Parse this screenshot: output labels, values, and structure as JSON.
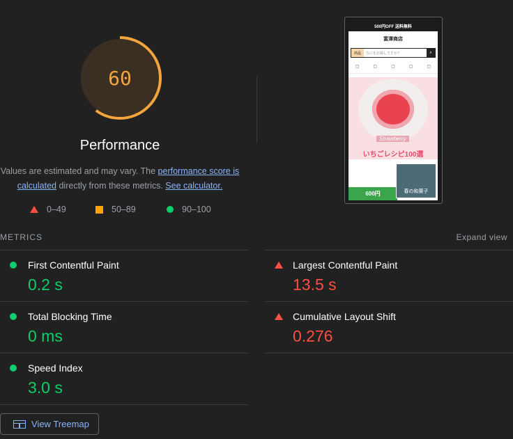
{
  "performance": {
    "score": "60",
    "score_value": 0.6,
    "title": "Performance",
    "gauge_color": "#f4a53c",
    "description_pre": "Values are estimated and may vary. The ",
    "description_link1": "performance score is calculated",
    "description_mid": " directly from these metrics. ",
    "description_link2": "See calculator."
  },
  "legend": [
    {
      "label": "0–49",
      "shape": "triangle",
      "color": "#ff4e42"
    },
    {
      "label": "50–89",
      "shape": "square",
      "color": "#ffa400"
    },
    {
      "label": "90–100",
      "shape": "circle",
      "color": "#0cce6b"
    }
  ],
  "screenshot": {
    "banner": "500円OFF 送料無料",
    "site_name": "富澤商店",
    "search_category": "商品",
    "search_placeholder": "なにをお探しですか?",
    "hero_label": "Strawberry",
    "hero_text": "いちごレシピ100選",
    "popup_text": "春の和菓子",
    "bottom_text": "600円"
  },
  "metrics": {
    "header": "METRICS",
    "expand_label": "Expand view",
    "left": [
      {
        "name": "First Contentful Paint",
        "value": "0.2 s",
        "status": "pass"
      },
      {
        "name": "Total Blocking Time",
        "value": "0 ms",
        "status": "pass"
      },
      {
        "name": "Speed Index",
        "value": "3.0 s",
        "status": "pass"
      }
    ],
    "right": [
      {
        "name": "Largest Contentful Paint",
        "value": "13.5 s",
        "status": "fail"
      },
      {
        "name": "Cumulative Layout Shift",
        "value": "0.276",
        "status": "fail"
      }
    ]
  },
  "treemap_button": "View Treemap"
}
